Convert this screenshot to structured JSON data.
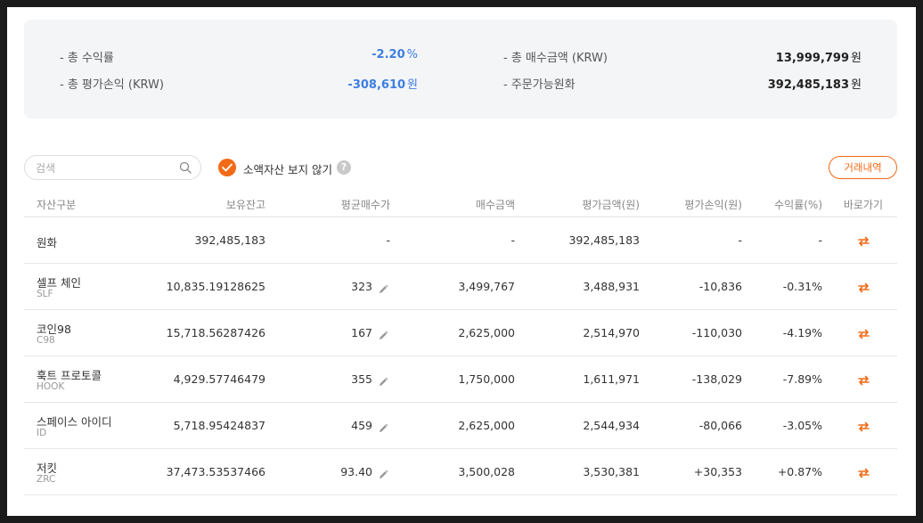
{
  "summary": {
    "total_return_label": "- 총 수익률",
    "total_return_value": "-2.20",
    "total_return_unit": "%",
    "total_pnl_label": "- 총 평가손익 (KRW)",
    "total_pnl_value": "-308,610",
    "total_pnl_unit": "원",
    "total_buy_label": "- 총 매수금액 (KRW)",
    "total_buy_value": "13,999,799",
    "total_buy_unit": "원",
    "orderable_label": "- 주문가능원화",
    "orderable_value": "392,485,183",
    "orderable_unit": "원"
  },
  "toolbar": {
    "search_placeholder": "검색",
    "hide_small_label": "소액자산 보지 않기",
    "help_glyph": "?",
    "history_button": "거래내역"
  },
  "table": {
    "headers": [
      "자산구분",
      "보유잔고",
      "평균매수가",
      "매수금액",
      "평가금액(원)",
      "평가손익(원)",
      "수익률(%)",
      "바로가기"
    ],
    "rows": [
      {
        "name": "원화",
        "symbol": "",
        "balance": "392,485,183",
        "avg_price": "-",
        "buy_amount": "-",
        "eval_amount": "392,485,183",
        "pnl": "-",
        "return": "-",
        "tone": "neutral",
        "editable": false
      },
      {
        "name": "셀프 체인",
        "symbol": "SLF",
        "balance": "10,835.19128625",
        "avg_price": "323",
        "buy_amount": "3,499,767",
        "eval_amount": "3,488,931",
        "pnl": "-10,836",
        "return": "-0.31%",
        "tone": "down",
        "editable": true
      },
      {
        "name": "코인98",
        "symbol": "C98",
        "balance": "15,718.56287426",
        "avg_price": "167",
        "buy_amount": "2,625,000",
        "eval_amount": "2,514,970",
        "pnl": "-110,030",
        "return": "-4.19%",
        "tone": "down",
        "editable": true
      },
      {
        "name": "훅트 프로토콜",
        "symbol": "HOOK",
        "balance": "4,929.57746479",
        "avg_price": "355",
        "buy_amount": "1,750,000",
        "eval_amount": "1,611,971",
        "pnl": "-138,029",
        "return": "-7.89%",
        "tone": "down",
        "editable": true
      },
      {
        "name": "스페이스 아이디",
        "symbol": "ID",
        "balance": "5,718.95424837",
        "avg_price": "459",
        "buy_amount": "2,625,000",
        "eval_amount": "2,544,934",
        "pnl": "-80,066",
        "return": "-3.05%",
        "tone": "down",
        "editable": true
      },
      {
        "name": "저킷",
        "symbol": "ZRC",
        "balance": "37,473.53537466",
        "avg_price": "93.40",
        "buy_amount": "3,500,028",
        "eval_amount": "3,530,381",
        "pnl": "+30,353",
        "return": "+0.87%",
        "tone": "up",
        "editable": true
      }
    ]
  },
  "colors": {
    "accent": "#f26a16",
    "down": "#3e7ee0",
    "up": "#e03e3e"
  },
  "icons": {
    "search": "search-icon",
    "check": "check-icon",
    "help": "help-icon",
    "edit": "pencil-icon",
    "go": "transfer-arrows-icon"
  }
}
